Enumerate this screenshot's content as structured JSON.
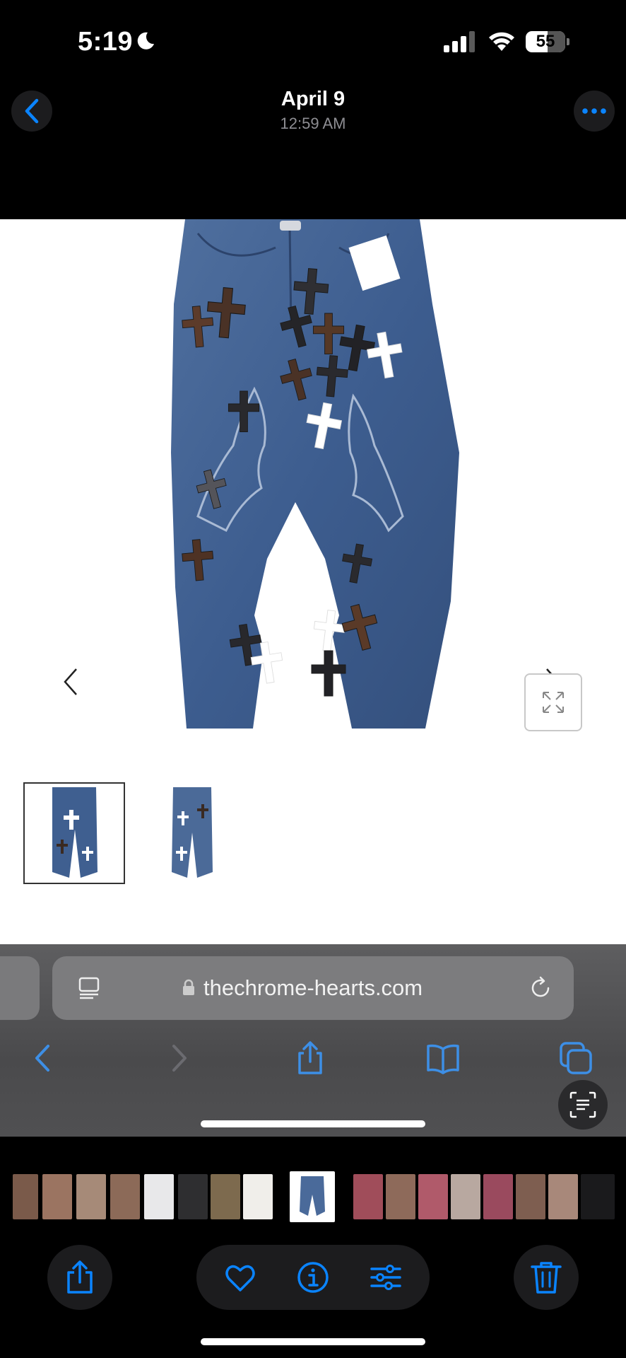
{
  "status_bar": {
    "time": "5:19",
    "battery": "55",
    "battery_level": 0.55,
    "icons": [
      "moon-icon",
      "signal-icon",
      "wifi-icon",
      "battery-icon"
    ]
  },
  "photo_header": {
    "date": "April 9",
    "time": "12:59 AM",
    "back_icon": "chevron-left-icon",
    "more_icon": "ellipsis-icon"
  },
  "web_page": {
    "product_image": "jeans-with-cross-patches",
    "thumbnails": [
      "jeans-front-thumbnail",
      "jeans-back-thumbnail"
    ],
    "selected_thumbnail": 0
  },
  "safari": {
    "url": "thechrome-hearts.com",
    "buttons": [
      "back",
      "forward",
      "share",
      "bookmarks",
      "tabs"
    ]
  },
  "toolbar": {
    "buttons": [
      "share",
      "favorite",
      "info",
      "adjust",
      "delete"
    ]
  },
  "colors": {
    "accent": "#0a84ff",
    "background": "#000000",
    "button_bg": "#1c1c1e",
    "secondary_text": "#8e8e93",
    "safari_bar": "#5e5e60"
  }
}
